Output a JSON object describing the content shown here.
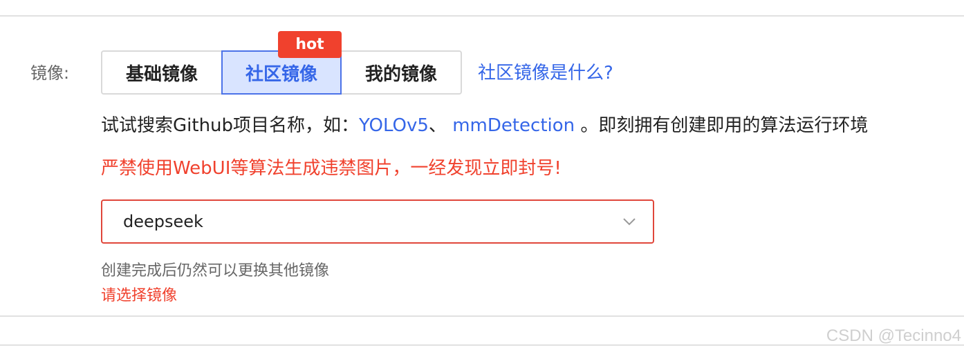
{
  "image_field": {
    "label": "镜像:",
    "tabs": [
      {
        "label": "基础镜像",
        "selected": false
      },
      {
        "label": "社区镜像",
        "selected": true
      },
      {
        "label": "我的镜像",
        "selected": false
      }
    ],
    "hot_badge": "hot",
    "help_link": "社区镜像是什么?"
  },
  "hint": {
    "prefix": "试试搜索Github项目名称，如：",
    "link1": "YOLOv5",
    "sep": "、 ",
    "link2": "mmDetection",
    "suffix": " 。即刻拥有创建即用的算法运行环境"
  },
  "warning": "严禁使用WebUI等算法生成违禁图片，一经发现立即封号!",
  "select": {
    "value": "deepseek",
    "icon": "chevron-down-icon"
  },
  "help_text": "创建完成后仍然可以更换其他镜像",
  "error_text": "请选择镜像",
  "watermark": "CSDN @Tecinno4",
  "colors": {
    "accent": "#3566e8",
    "accent_bg": "#d9e4ff",
    "danger": "#f0412d",
    "border": "#d9d9d9"
  }
}
